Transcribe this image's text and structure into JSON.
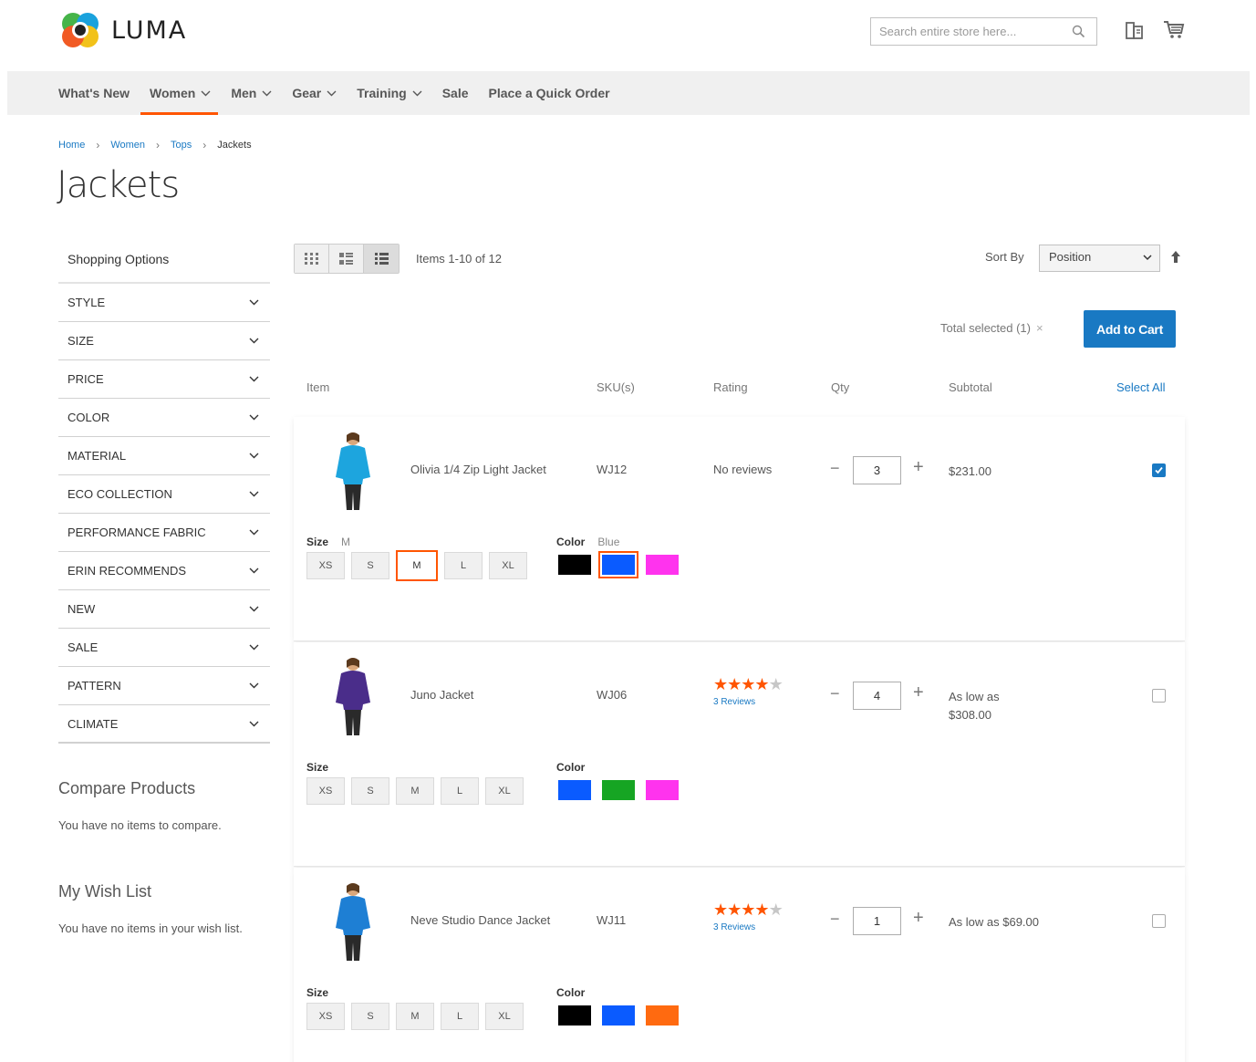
{
  "brand": {
    "name": "LUMA"
  },
  "search": {
    "placeholder": "Search entire store here..."
  },
  "nav": [
    {
      "label": "What's New",
      "dropdown": false,
      "active": false
    },
    {
      "label": "Women",
      "dropdown": true,
      "active": true
    },
    {
      "label": "Men",
      "dropdown": true,
      "active": false
    },
    {
      "label": "Gear",
      "dropdown": true,
      "active": false
    },
    {
      "label": "Training",
      "dropdown": true,
      "active": false
    },
    {
      "label": "Sale",
      "dropdown": false,
      "active": false
    },
    {
      "label": "Place a Quick Order",
      "dropdown": false,
      "active": false
    }
  ],
  "breadcrumb": [
    "Home",
    "Women",
    "Tops",
    "Jackets"
  ],
  "page_title": "Jackets",
  "sidebar": {
    "title": "Shopping Options",
    "filters": [
      "STYLE",
      "SIZE",
      "PRICE",
      "COLOR",
      "MATERIAL",
      "ECO COLLECTION",
      "PERFORMANCE FABRIC",
      "ERIN RECOMMENDS",
      "NEW",
      "SALE",
      "PATTERN",
      "CLIMATE"
    ],
    "compare": {
      "title": "Compare Products",
      "text": "You have no items to compare."
    },
    "wishlist": {
      "title": "My Wish List",
      "text": "You have no items in your wish list."
    }
  },
  "toolbar": {
    "items_count": "Items 1-10 of 12",
    "sort_label": "Sort By",
    "sort_value": "Position"
  },
  "selection": {
    "total_selected": "Total selected (1)",
    "close": "×",
    "add_to_cart": "Add to Cart"
  },
  "columns": {
    "item": "Item",
    "sku": "SKU(s)",
    "rating": "Rating",
    "qty": "Qty",
    "subtotal": "Subtotal",
    "select_all": "Select All"
  },
  "colors": {
    "accent": "#ff5501",
    "link": "#1979c3"
  },
  "products": [
    {
      "name": "Olivia 1/4 Zip Light Jacket",
      "sku": "WJ12",
      "rating_text": "No reviews",
      "qty": "3",
      "subtotal_line1": "$231.00",
      "subtotal_line2": "",
      "checked": true,
      "size_label": "Size",
      "size_selected": "M",
      "sizes": [
        "XS",
        "S",
        "M",
        "L",
        "XL"
      ],
      "color_label": "Color",
      "color_selected": "Blue",
      "colors": [
        "#000000",
        "#0a5bff",
        "#ff33ee"
      ]
    },
    {
      "name": "Juno Jacket",
      "sku": "WJ06",
      "rating": 4.5,
      "reviews": "3 Reviews",
      "qty": "4",
      "subtotal_line1": "As low as",
      "subtotal_line2": "$308.00",
      "checked": false,
      "size_label": "Size",
      "size_selected": "",
      "sizes": [
        "XS",
        "S",
        "M",
        "L",
        "XL"
      ],
      "color_label": "Color",
      "color_selected": "",
      "colors": [
        "#0a5bff",
        "#16a523",
        "#ff33ee"
      ]
    },
    {
      "name": "Neve Studio Dance Jacket",
      "sku": "WJ11",
      "rating": 4.5,
      "reviews": "3 Reviews",
      "qty": "1",
      "subtotal_line1": "As low as $69.00",
      "subtotal_line2": "",
      "checked": false,
      "size_label": "Size",
      "size_selected": "",
      "sizes": [
        "XS",
        "S",
        "M",
        "L",
        "XL"
      ],
      "color_label": "Color",
      "color_selected": "",
      "colors": [
        "#000000",
        "#0a5bff",
        "#ff6a10"
      ]
    }
  ]
}
